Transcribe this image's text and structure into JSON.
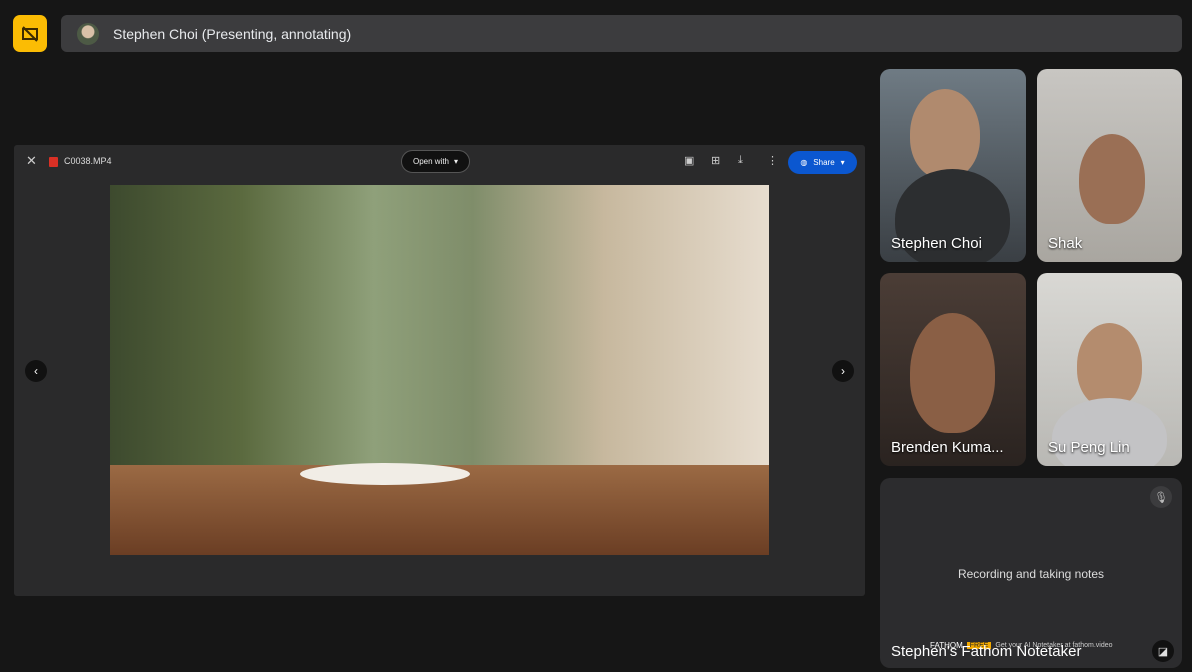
{
  "presenter_bar": {
    "label": "Stephen Choi (Presenting, annotating)"
  },
  "viewer": {
    "file_name": "C0038.MP4",
    "open_with": "Open with",
    "share": "Share",
    "close": "✕"
  },
  "participants": [
    {
      "name": "Stephen Choi"
    },
    {
      "name": "Shak"
    },
    {
      "name": "Brenden Kuma..."
    },
    {
      "name": "Su Peng Lin"
    }
  ],
  "notetaker": {
    "status": "Recording and taking notes",
    "name": "Stephen's Fathom Notetaker",
    "brand": "FATHOM",
    "badge": "FREE",
    "promo": "Get your AI Notetaker at fathom.video"
  },
  "colors": {
    "stop_button": "#fbbc04",
    "share": "#0b57d0"
  }
}
